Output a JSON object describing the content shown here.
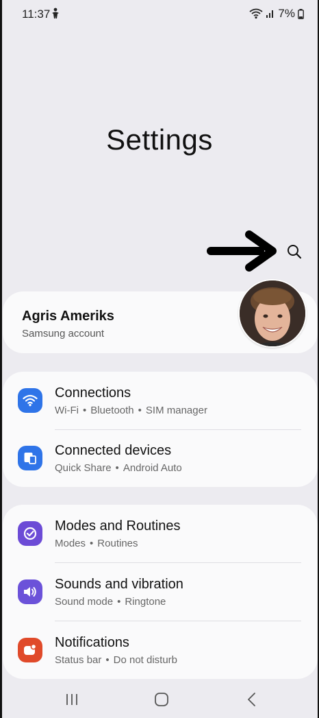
{
  "status_bar": {
    "time": "11:37",
    "battery": "7%",
    "left_icon": "accessibility-icon",
    "right_icons": [
      "wifi-icon",
      "signal-icon",
      "battery-icon"
    ]
  },
  "header": {
    "title": "Settings",
    "search_icon": "search-icon",
    "annotation_icon": "arrow-right-icon"
  },
  "account": {
    "name": "Agris Ameriks",
    "subtitle": "Samsung account",
    "avatar_icon": "avatar-photo"
  },
  "groups": [
    {
      "items": [
        {
          "title": "Connections",
          "sub": [
            "Wi-Fi",
            "Bluetooth",
            "SIM manager"
          ],
          "icon": "wifi-icon",
          "color": "#2f74e8"
        },
        {
          "title": "Connected devices",
          "sub": [
            "Quick Share",
            "Android Auto"
          ],
          "icon": "devices-icon",
          "color": "#2f74e8"
        }
      ]
    },
    {
      "items": [
        {
          "title": "Modes and Routines",
          "sub": [
            "Modes",
            "Routines"
          ],
          "icon": "check-circle-icon",
          "color": "#6c4bd6"
        },
        {
          "title": "Sounds and vibration",
          "sub": [
            "Sound mode",
            "Ringtone"
          ],
          "icon": "speaker-icon",
          "color": "#6b52d9"
        },
        {
          "title": "Notifications",
          "sub": [
            "Status bar",
            "Do not disturb"
          ],
          "icon": "notification-icon",
          "color": "#e04a2a"
        }
      ]
    }
  ],
  "nav_bar": {
    "icons": [
      "recents-icon",
      "home-icon",
      "back-icon"
    ]
  }
}
